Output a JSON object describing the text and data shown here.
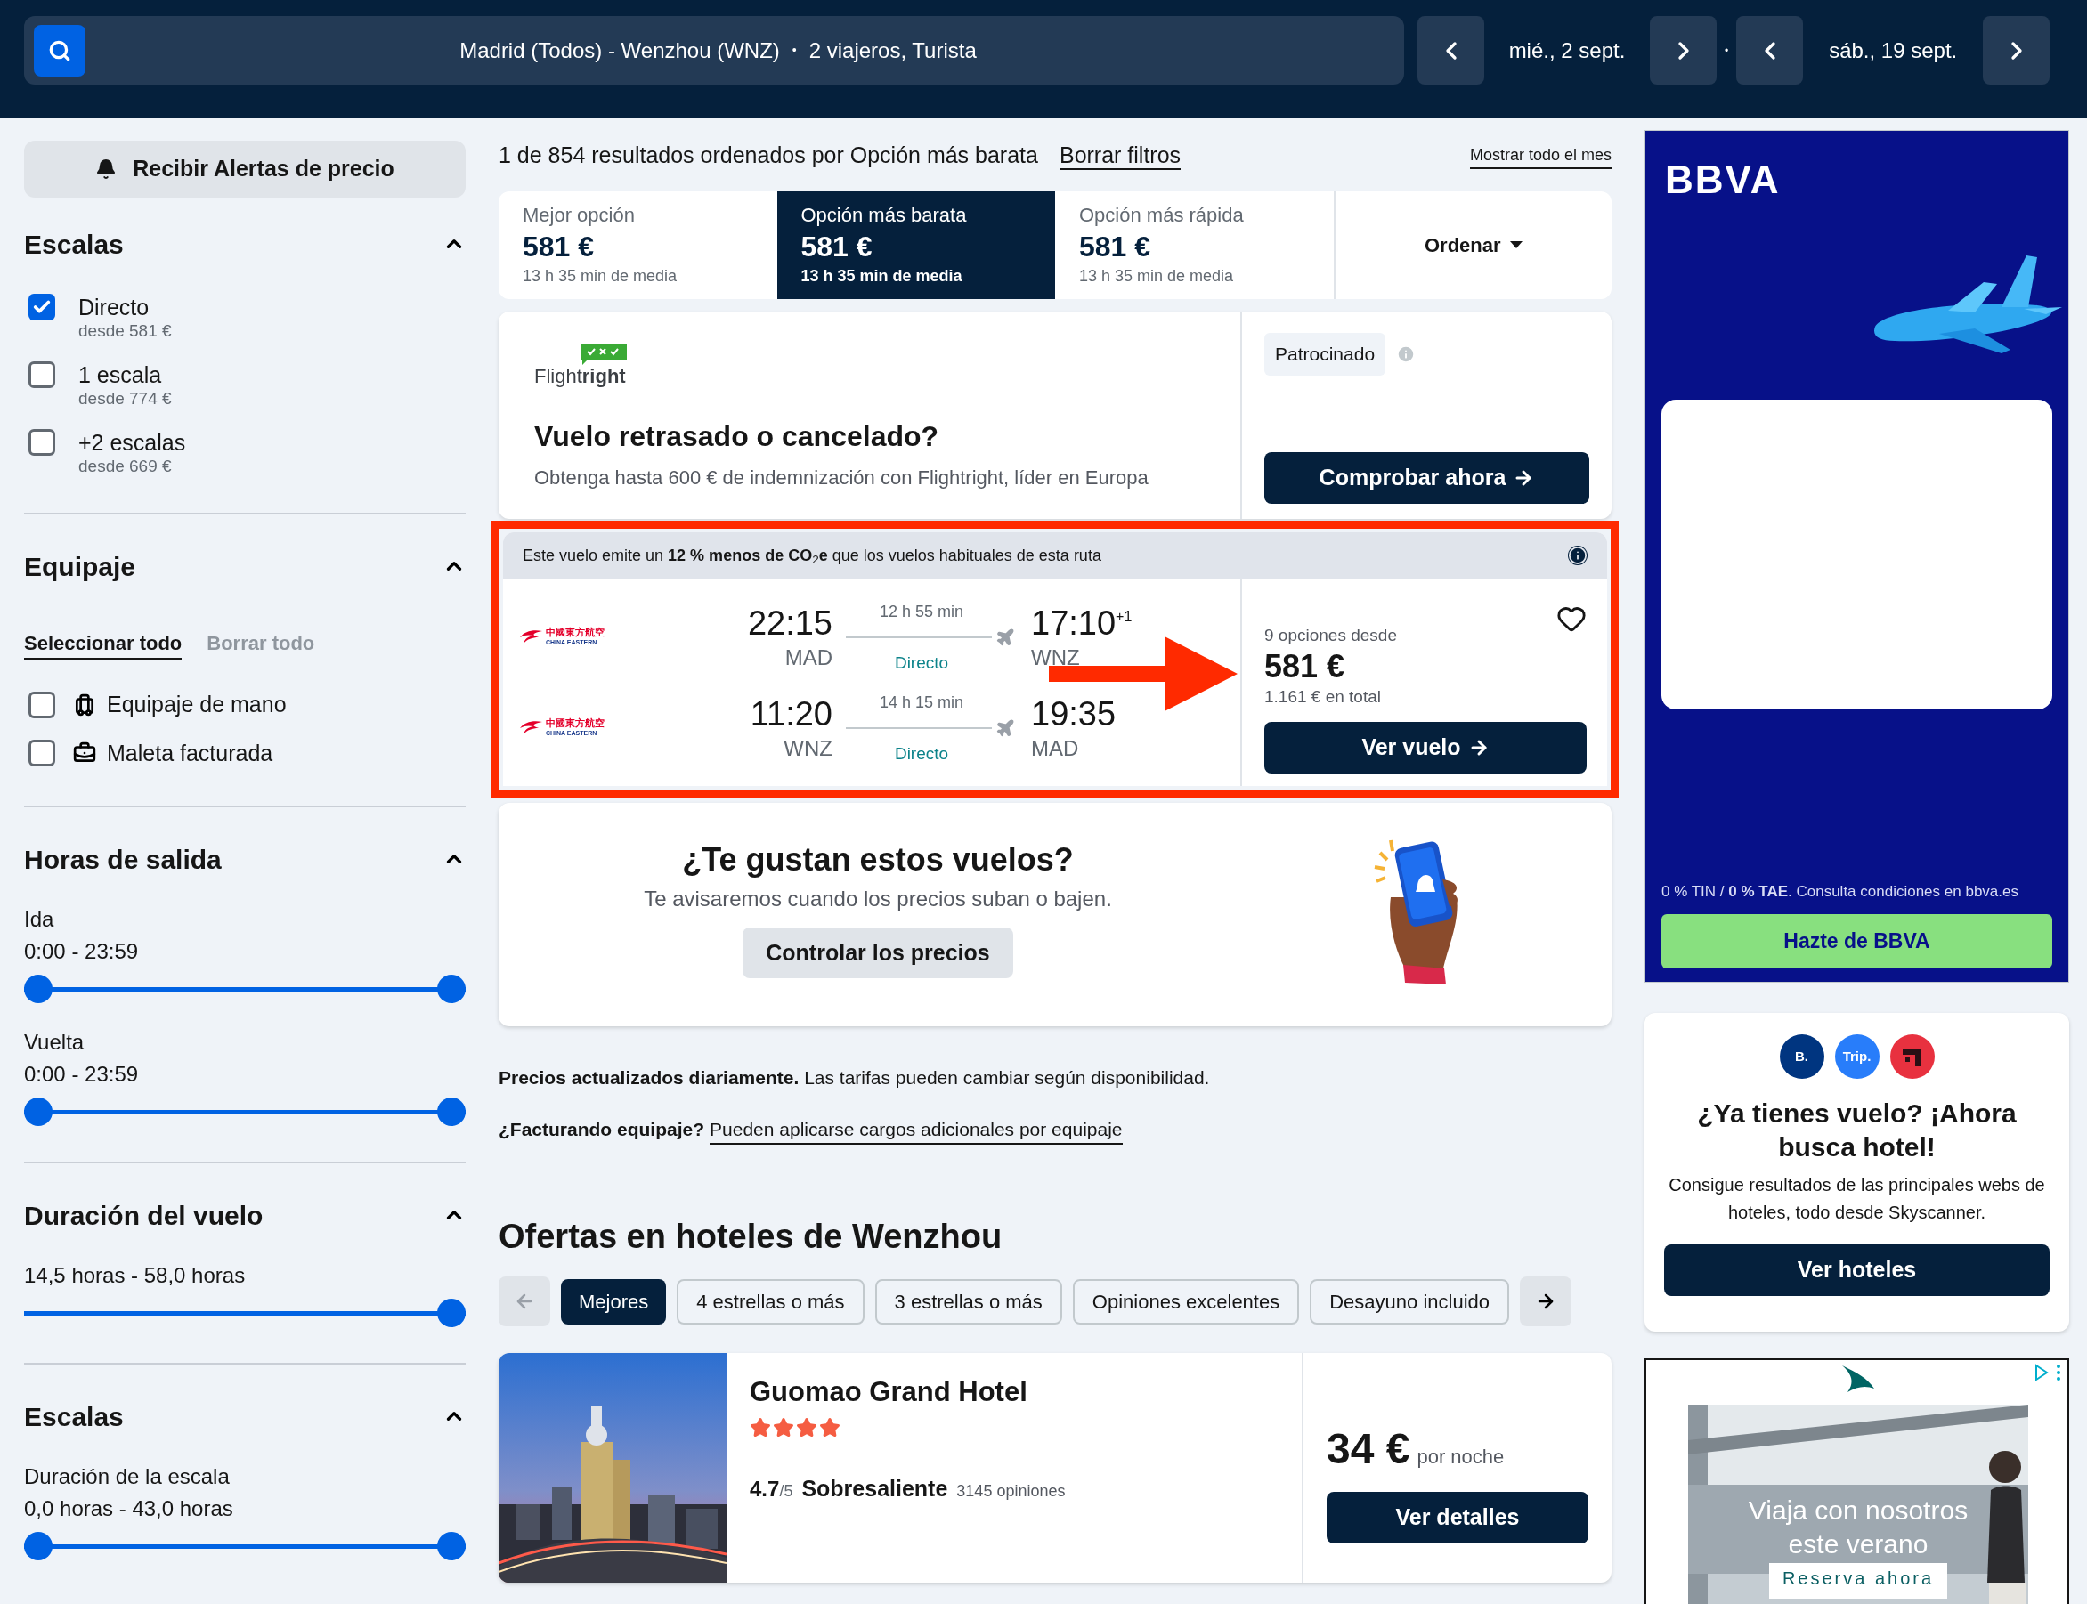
{
  "search": {
    "route": "Madrid (Todos) - Wenzhou (WNZ)",
    "separator": "•",
    "travellers": "2 viajeros, Turista",
    "depart_date": "mié., 2 sept.",
    "date_separator": "•",
    "return_date": "sáb., 19 sept."
  },
  "alert_button": "Recibir Alertas de precio",
  "filters": [
    {
      "kind": "checkboxes",
      "title": "Escalas",
      "expanded": true,
      "options": [
        {
          "label": "Directo",
          "note": "desde 581 €",
          "checked": true
        },
        {
          "label": "1 escala",
          "note": "desde 774 €",
          "checked": false
        },
        {
          "label": "+2 escalas",
          "note": "desde 669 €",
          "checked": false
        }
      ]
    },
    {
      "kind": "baggage",
      "title": "Equipaje",
      "expanded": true,
      "select_all": "Seleccionar todo",
      "clear_all": "Borrar todo",
      "clear_all_disabled": true,
      "options": [
        {
          "label": "Equipaje de mano",
          "checked": false
        },
        {
          "label": "Maleta facturada",
          "checked": false
        }
      ]
    },
    {
      "kind": "sliders",
      "title": "Horas de salida",
      "expanded": true,
      "sliders": [
        {
          "kind": "range",
          "label": "Ida",
          "range": "0:00 - 23:59",
          "level": 1
        },
        {
          "kind": "range",
          "label": "Vuelta",
          "range": "0:00 - 23:59",
          "level": 1
        }
      ]
    },
    {
      "kind": "sliders",
      "title": "Duración del vuelo",
      "expanded": true,
      "sliders": [
        {
          "kind": "single",
          "range": "14,5 horas - 58,0 horas",
          "level": 1
        }
      ]
    },
    {
      "kind": "sliders",
      "title": "Escalas",
      "expanded": true,
      "sliders": [
        {
          "kind": "range",
          "label": "Duración de la escala",
          "range": "0,0 horas - 43,0 horas",
          "level": 1
        }
      ]
    }
  ],
  "results": {
    "summary": "1 de 854 resultados ordenados por Opción más barata",
    "clear_filters": "Borrar filtros",
    "month_link": "Mostrar todo el mes"
  },
  "sort_tabs": [
    {
      "label": "Mejor opción",
      "price": "581 €",
      "duration": "13 h 35 min de media",
      "selected": false
    },
    {
      "label": "Opción más barata",
      "price": "581 €",
      "duration": "13 h 35 min de media",
      "selected": true
    },
    {
      "label": "Opción más rápida",
      "price": "581 €",
      "duration": "13 h 35 min de media",
      "selected": false
    }
  ],
  "sort_button": "Ordenar",
  "sponsored": {
    "logo": "Flight**right**",
    "title": "Vuelo retrasado o cancelado?",
    "text": "Obtenga hasta 600 € de indemnización con Flightright, líder en Europa",
    "badge": "Patrocinado",
    "button": "Comprobar ahora"
  },
  "flight": {
    "eco_note": "Este vuelo emite un **12 % menos de CO**$_{2}$**e** que los vuelos habituales de esta ruta",
    "legs": [
      {
        "airline_local": "中國東方航空",
        "airline": "CHINA EASTERN",
        "dep_time": "22:15",
        "dep_airport": "MAD",
        "duration": "12 h 55 min",
        "stops": "Directo",
        "arr_time": "17:10",
        "arr_offset": "+1",
        "arr_airport": "WNZ"
      },
      {
        "airline_local": "中國東方航空",
        "airline": "CHINA EASTERN",
        "dep_time": "11:20",
        "dep_airport": "WNZ",
        "duration": "14 h 15 min",
        "stops": "Directo",
        "arr_time": "19:35",
        "arr_airport": "MAD"
      }
    ],
    "options": "9 opciones desde",
    "price": "581 €",
    "total": "1.161 € en total",
    "button": "Ver vuelo",
    "favorite": false
  },
  "price_alert": {
    "title": "¿Te gustan estos vuelos?",
    "text": "Te avisaremos cuando los precios suban o bajen.",
    "button": "Controlar los precios"
  },
  "notes": {
    "updated": "**Precios actualizados diariamente.** Las tarifas pueden cambiar según disponibilidad.",
    "baggage_lead": "¿Facturando equipaje?",
    "baggage_link": "Pueden aplicarse cargos adicionales por equipaje"
  },
  "hotels": {
    "title": "Ofertas en hoteles de Wenzhou",
    "prev_disabled": true,
    "chips": [
      {
        "label": "Mejores",
        "selected": true
      },
      {
        "label": "4 estrellas o más",
        "selected": false
      },
      {
        "label": "3 estrellas o más",
        "selected": false
      },
      {
        "label": "Opiniones excelentes",
        "selected": false
      },
      {
        "label": "Desayuno incluido",
        "selected": false
      }
    ],
    "hotel": {
      "name": "Guomao Grand Hotel",
      "stars": 4,
      "score": "4.7",
      "scale": "/5",
      "rating": "Sobresaliente",
      "reviews": "3145 opiniones",
      "price": "34 €",
      "per": "por noche",
      "button": "Ver detalles"
    }
  },
  "ads": {
    "bbva": {
      "logo": "BBVA",
      "terms": "0 % TIN / **0 % TAE**. Consulta condiciones en bbva.es",
      "button": "Hazte de BBVA"
    },
    "hotel_promo": {
      "logos": [
        {
          "text": "B.",
          "color": "#003580"
        },
        {
          "text": "Trip.",
          "color": "#287dfa"
        }
      ],
      "title": "¿Ya tienes vuelo? ¡Ahora busca hotel!",
      "text": "Consigue resultados de las principales webs de hoteles, todo desde Skyscanner.",
      "button": "Ver hoteles"
    },
    "travel": {
      "headline": "Viaja con nosotros este verano",
      "button": "Reserva ahora"
    }
  }
}
